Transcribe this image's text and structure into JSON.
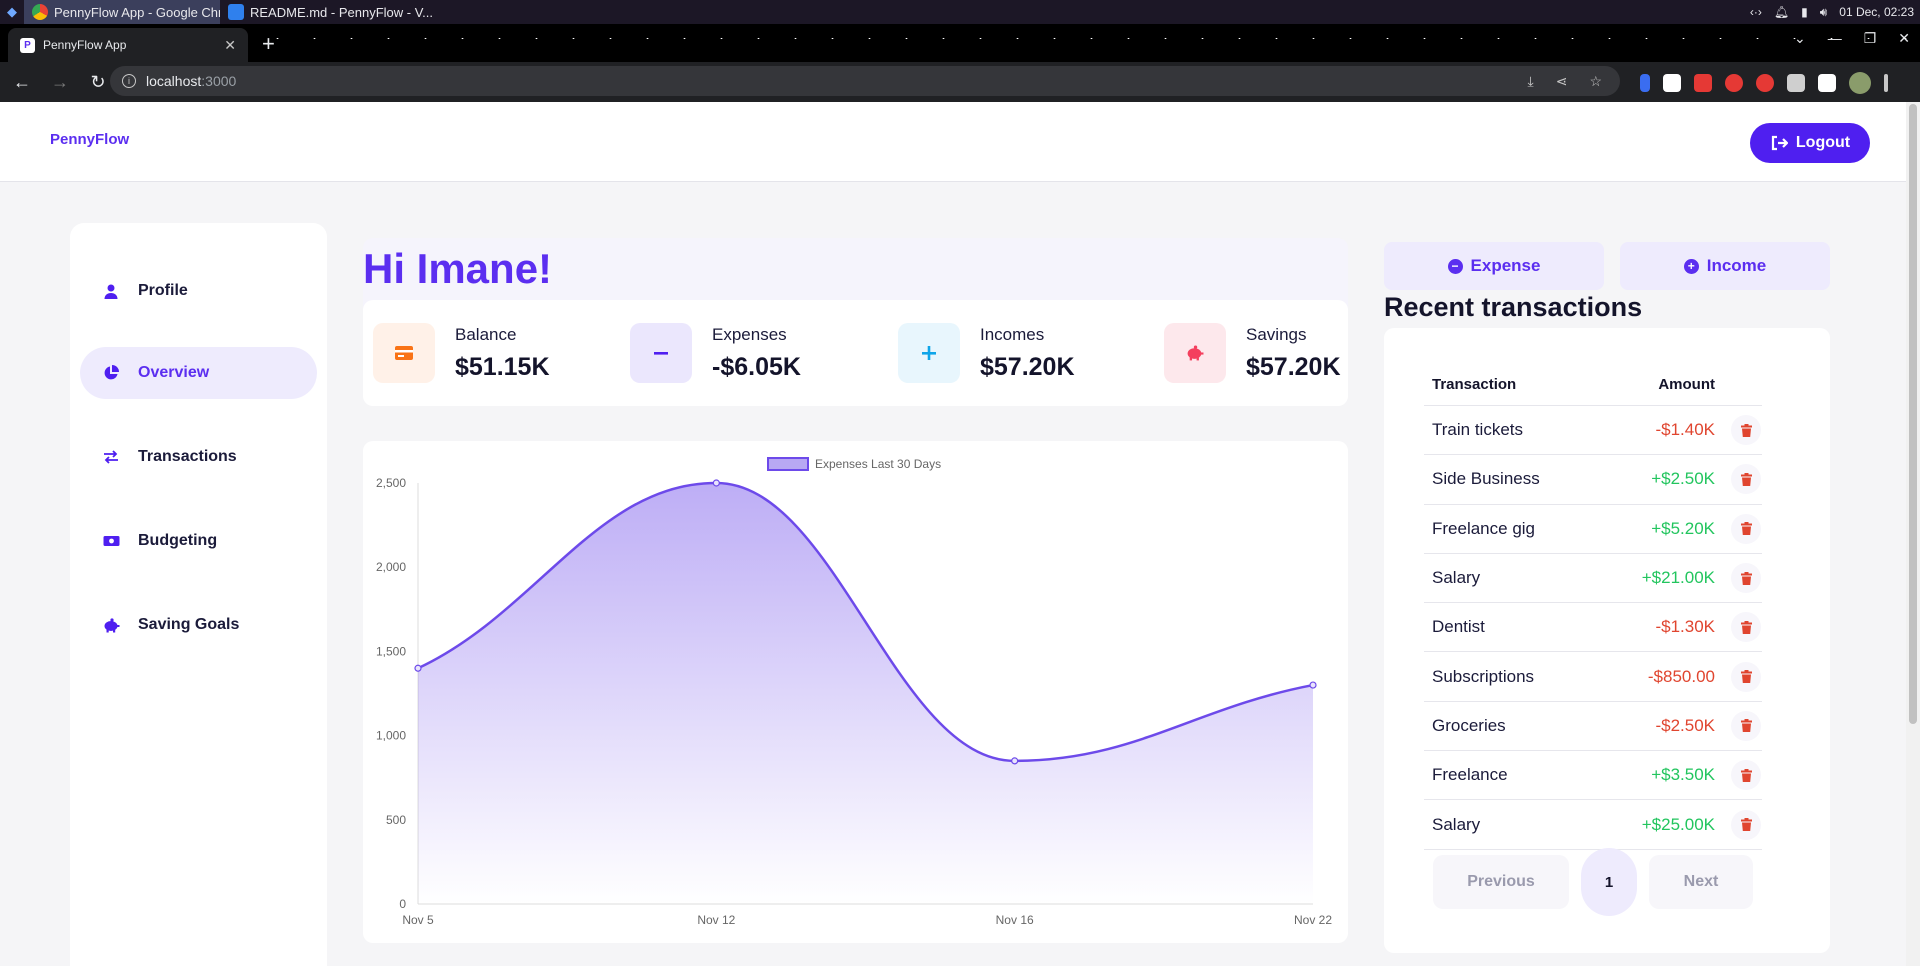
{
  "os": {
    "tasks": [
      {
        "label": "PennyFlow App - Google Chr...",
        "color": "#4285f4"
      },
      {
        "label": "README.md - PennyFlow - V...",
        "color": "#2f80ed"
      }
    ],
    "clock": "01 Dec, 02:23"
  },
  "browser": {
    "tab_title": "PennyFlow App",
    "url_host": "localhost",
    "url_port": ":3000"
  },
  "header": {
    "brand": "PennyFlow",
    "logout_label": "Logout"
  },
  "sidebar": {
    "items": [
      {
        "label": "Profile",
        "icon": "user-icon"
      },
      {
        "label": "Overview",
        "icon": "pie-chart-icon",
        "active": true
      },
      {
        "label": "Transactions",
        "icon": "arrows-exchange-icon"
      },
      {
        "label": "Budgeting",
        "icon": "money-bill-icon"
      },
      {
        "label": "Saving Goals",
        "icon": "piggy-bank-icon"
      }
    ]
  },
  "main": {
    "greeting": "Hi Imane!",
    "stats": [
      {
        "label": "Balance",
        "value": "$51.15K",
        "icon": "wallet-icon",
        "color": "#f97316",
        "bg": "#fff1e8"
      },
      {
        "label": "Expenses",
        "value": "-$6.05K",
        "icon": "minus-icon",
        "color": "#4f1ff0",
        "bg": "#ebe7fd"
      },
      {
        "label": "Incomes",
        "value": "$57.20K",
        "icon": "plus-icon",
        "color": "#0ea5e9",
        "bg": "#e8f6fd"
      },
      {
        "label": "Savings",
        "value": "$57.20K",
        "icon": "piggy-bank-icon",
        "color": "#f43f5e",
        "bg": "#fde8ec"
      }
    ]
  },
  "chart_data": {
    "type": "line",
    "legend": "Expenses Last 30 Days",
    "x": [
      "Nov 5",
      "Nov 12",
      "Nov 16",
      "Nov 22"
    ],
    "values": [
      1400,
      2500,
      850,
      1300
    ],
    "yticks": [
      0,
      500,
      1000,
      1500,
      2000,
      2500
    ],
    "ytick_labels": [
      "0",
      "500",
      "1,000",
      "1,500",
      "2,000",
      "2,500"
    ],
    "ylim": [
      0,
      2500
    ],
    "color": "#6d4aea",
    "fill": "gradient",
    "legend_position": "top-center"
  },
  "actions": {
    "expense_label": "Expense",
    "income_label": "Income"
  },
  "transactions": {
    "title": "Recent transactions",
    "col_transaction": "Transaction",
    "col_amount": "Amount",
    "rows": [
      {
        "name": "Train tickets",
        "amount": "-$1.40K",
        "type": "neg"
      },
      {
        "name": "Side Business",
        "amount": "+$2.50K",
        "type": "pos"
      },
      {
        "name": "Freelance gig",
        "amount": "+$5.20K",
        "type": "pos"
      },
      {
        "name": "Salary",
        "amount": "+$21.00K",
        "type": "pos"
      },
      {
        "name": "Dentist",
        "amount": "-$1.30K",
        "type": "neg"
      },
      {
        "name": "Subscriptions",
        "amount": "-$850.00",
        "type": "neg"
      },
      {
        "name": "Groceries",
        "amount": "-$2.50K",
        "type": "neg"
      },
      {
        "name": "Freelance",
        "amount": "+$3.50K",
        "type": "pos"
      },
      {
        "name": "Salary",
        "amount": "+$25.00K",
        "type": "pos"
      }
    ],
    "prev_label": "Previous",
    "page": "1",
    "next_label": "Next"
  }
}
